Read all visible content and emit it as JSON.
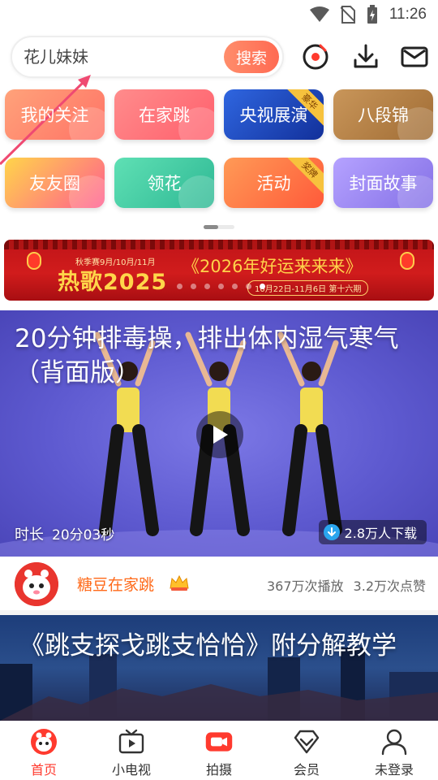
{
  "status_bar": {
    "time": "11:26"
  },
  "search": {
    "value": "花儿妹妹",
    "button_label": "搜索"
  },
  "categories": [
    {
      "label": "我的关注",
      "color": "#ff8a6a"
    },
    {
      "label": "在家跳",
      "color": "#ff6f76"
    },
    {
      "label": "央视展演",
      "color": "#1b49b8",
      "badge": "豪华"
    },
    {
      "label": "八段锦",
      "color": "#b58448"
    },
    {
      "label": "友友圈",
      "color": "#ff5d8f"
    },
    {
      "label": "领花",
      "color": "#35c4a0"
    },
    {
      "label": "活动",
      "color": "#ff6a3a",
      "badge": "奖牌"
    },
    {
      "label": "封面故事",
      "color": "#9a86f0"
    }
  ],
  "banner": {
    "subtitle": "秋季赛9月/10月/11月",
    "big_title": "热歌2025",
    "title": "《2026年好运来来来》",
    "date": "10月22日-11月6日 第十六期"
  },
  "video1": {
    "title": "20分钟排毒操，排出体内湿气寒气（背面版）",
    "duration_label": "时长",
    "duration": "20分03秒",
    "downloads": "2.8万人下载"
  },
  "author": {
    "name": "糖豆在家跳",
    "plays": "367万次播放",
    "likes": "3.2万次点赞"
  },
  "video2": {
    "title": "《跳支探戈跳支恰恰》附分解教学"
  },
  "bottom_nav": [
    {
      "label": "首页",
      "icon": "home-icon",
      "active": true
    },
    {
      "label": "小电视",
      "icon": "tv-icon",
      "active": false
    },
    {
      "label": "拍摄",
      "icon": "camera-icon",
      "active": false
    },
    {
      "label": "会员",
      "icon": "vip-diamond-icon",
      "active": false
    },
    {
      "label": "未登录",
      "icon": "user-icon",
      "active": false
    }
  ],
  "colors": {
    "accent": "#ff3a2e",
    "search_button": "#ff7a5a",
    "author_name": "#ff6a1a"
  }
}
